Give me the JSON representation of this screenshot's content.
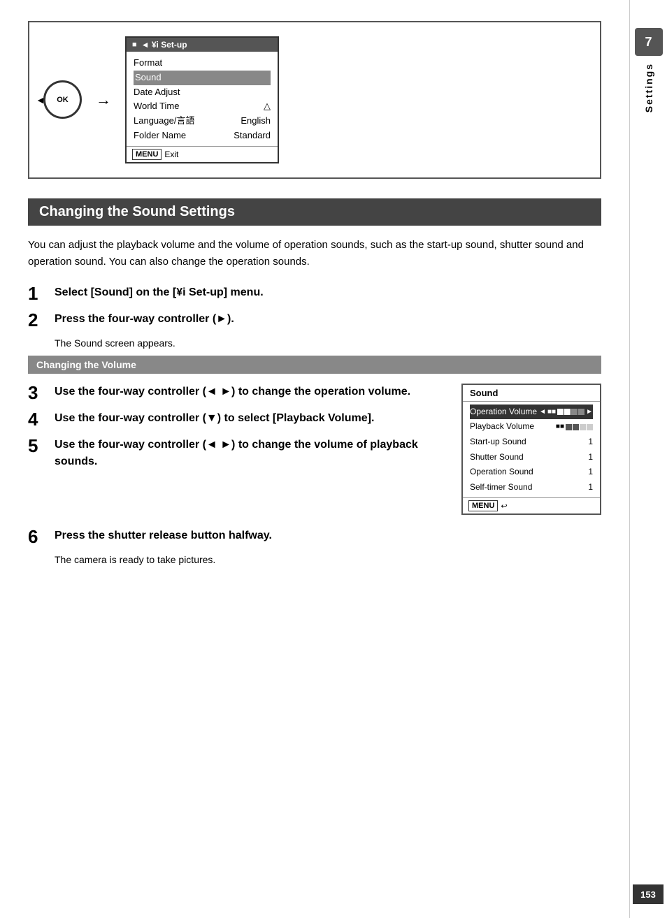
{
  "illustration": {
    "ok_label": "OK",
    "menu_header": "◄ ¥i Set-up",
    "menu_icon": "■",
    "menu_items": [
      {
        "label": "Format",
        "value": ""
      },
      {
        "label": "Sound",
        "value": ""
      },
      {
        "label": "Date Adjust",
        "value": ""
      },
      {
        "label": "World Time",
        "value": "△"
      },
      {
        "label": "Language/言語",
        "value": "English"
      },
      {
        "label": "Folder Name",
        "value": "Standard"
      }
    ],
    "menu_footer": "Exit"
  },
  "section": {
    "heading": "Changing the Sound Settings",
    "intro": "You can adjust the playback volume and the volume of operation sounds, such as the start-up sound, shutter sound and operation sound. You can also change the operation sounds."
  },
  "steps": [
    {
      "number": "1",
      "text": "Select [Sound] on the [¥i Set-up] menu."
    },
    {
      "number": "2",
      "text": "Press the four-way controller (►).",
      "sub": "The Sound screen appears."
    }
  ],
  "sub_section": {
    "heading": "Changing the Volume"
  },
  "steps2": [
    {
      "number": "3",
      "text": "Use the four-way controller (◄ ►) to change the operation volume."
    },
    {
      "number": "4",
      "text": "Use the four-way controller (▼) to select [Playback Volume]."
    },
    {
      "number": "5",
      "text": "Use the four-way controller (◄ ►) to change the volume of playback sounds."
    }
  ],
  "step6": {
    "number": "6",
    "text": "Press the shutter release button halfway.",
    "sub": "The camera is ready to take pictures."
  },
  "sound_panel": {
    "header": "Sound",
    "rows": [
      {
        "label": "Operation Volume",
        "value": "",
        "type": "volume_bar",
        "highlighted": true
      },
      {
        "label": "Playback Volume",
        "value": "",
        "type": "volume_bar",
        "highlighted": false
      },
      {
        "label": "Start-up Sound",
        "value": "1",
        "type": "text",
        "highlighted": false
      },
      {
        "label": "Shutter Sound",
        "value": "1",
        "type": "text",
        "highlighted": false
      },
      {
        "label": "Operation Sound",
        "value": "1",
        "type": "text",
        "highlighted": false
      },
      {
        "label": "Self-timer Sound",
        "value": "1",
        "type": "text",
        "highlighted": false
      }
    ],
    "footer_icon": "MENU",
    "footer_arrow": "↩"
  },
  "sidebar": {
    "number": "7",
    "label": "Settings"
  },
  "page_number": "153"
}
